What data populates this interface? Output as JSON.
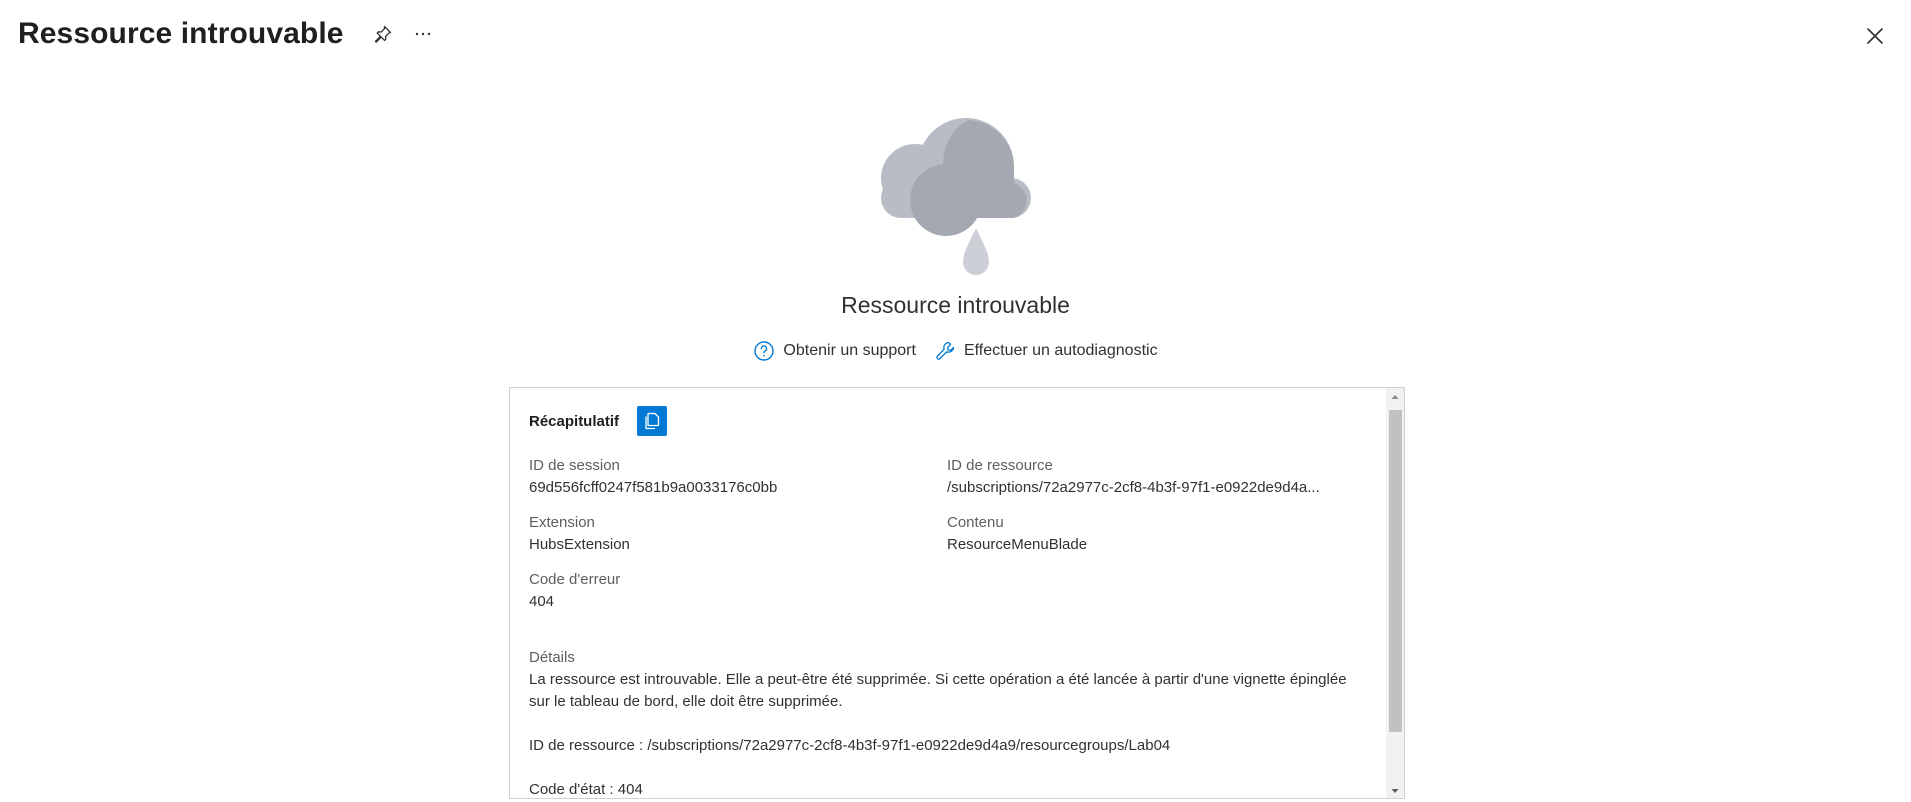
{
  "header": {
    "title": "Ressource introuvable",
    "icons": {
      "pin": "pin-icon",
      "more": "more-icon",
      "close": "close-icon"
    }
  },
  "error": {
    "illustration": "rain-cloud",
    "title": "Ressource introuvable"
  },
  "actions": {
    "support_label": "Obtenir un support",
    "diagnostic_label": "Effectuer un autodiagnostic"
  },
  "summary": {
    "label": "Récapitulatif",
    "fields": {
      "session_id_label": "ID de session",
      "session_id_value": "69d556fcff0247f581b9a0033176c0bb",
      "resource_id_label": "ID de ressource",
      "resource_id_value": "/subscriptions/72a2977c-2cf8-4b3f-97f1-e0922de9d4a...",
      "extension_label": "Extension",
      "extension_value": "HubsExtension",
      "content_label": "Contenu",
      "content_value": "ResourceMenuBlade",
      "error_code_label": "Code d'erreur",
      "error_code_value": "404"
    },
    "details": {
      "label": "Détails",
      "line1": "La ressource est introuvable. Elle a peut-être été supprimée. Si cette opération a été lancée à partir d'une vignette épinglée sur le tableau de bord, elle doit être supprimée.",
      "line2": "ID de ressource : /subscriptions/72a2977c-2cf8-4b3f-97f1-e0922de9d4a9/resourcegroups/Lab04",
      "line3": "Code d'état : 404"
    }
  },
  "colors": {
    "accent": "#0078d4",
    "cloud_light": "#b8bdc5",
    "cloud_dark": "#a3a8b1",
    "drop": "#ccd0d6"
  }
}
